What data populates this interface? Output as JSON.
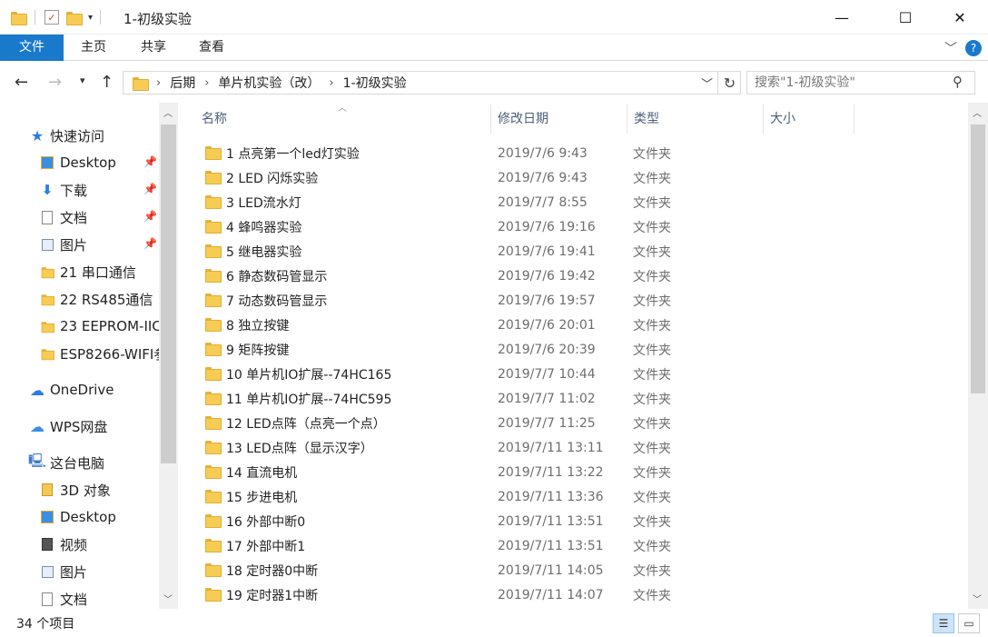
{
  "window": {
    "title": "1-初级实验",
    "minimize": "—",
    "maximize": "☐",
    "close": "✕"
  },
  "ribbon": {
    "tabs": [
      "文件",
      "主页",
      "共享",
      "查看"
    ],
    "help": "?"
  },
  "address": {
    "crumbs": [
      "后期",
      "单片机实验（改）",
      "1-初级实验"
    ]
  },
  "search": {
    "placeholder": "搜索\"1-初级实验\""
  },
  "navpane": {
    "quick_access": "快速访问",
    "items": [
      {
        "label": "Desktop",
        "pinned": true
      },
      {
        "label": "下载",
        "pinned": true
      },
      {
        "label": "文档",
        "pinned": true
      },
      {
        "label": "图片",
        "pinned": true
      },
      {
        "label": "21 串口通信",
        "pinned": false
      },
      {
        "label": "22 RS485通信",
        "pinned": false
      },
      {
        "label": "23 EEPROM-IIC",
        "pinned": false
      },
      {
        "label": "ESP8266-WIFI参",
        "pinned": false
      }
    ],
    "onedrive": "OneDrive",
    "wps": "WPS网盘",
    "this_pc": "这台电脑",
    "pc_items": [
      "3D 对象",
      "Desktop",
      "视频",
      "图片",
      "文档"
    ]
  },
  "columns": {
    "name": "名称",
    "date": "修改日期",
    "type": "类型",
    "size": "大小"
  },
  "files": [
    {
      "name": "1 点亮第一个led灯实验",
      "date": "2019/7/6 9:43",
      "type": "文件夹"
    },
    {
      "name": "2 LED 闪烁实验",
      "date": "2019/7/6 9:43",
      "type": "文件夹"
    },
    {
      "name": "3 LED流水灯",
      "date": "2019/7/7 8:55",
      "type": "文件夹"
    },
    {
      "name": "4 蜂鸣器实验",
      "date": "2019/7/6 19:16",
      "type": "文件夹"
    },
    {
      "name": "5 继电器实验",
      "date": "2019/7/6 19:41",
      "type": "文件夹"
    },
    {
      "name": "6 静态数码管显示",
      "date": "2019/7/6 19:42",
      "type": "文件夹"
    },
    {
      "name": "7 动态数码管显示",
      "date": "2019/7/6 19:57",
      "type": "文件夹"
    },
    {
      "name": "8 独立按键",
      "date": "2019/7/6 20:01",
      "type": "文件夹"
    },
    {
      "name": "9 矩阵按键",
      "date": "2019/7/6 20:39",
      "type": "文件夹"
    },
    {
      "name": "10 单片机IO扩展--74HC165",
      "date": "2019/7/7 10:44",
      "type": "文件夹"
    },
    {
      "name": "11 单片机IO扩展--74HC595",
      "date": "2019/7/7 11:02",
      "type": "文件夹"
    },
    {
      "name": "12 LED点阵（点亮一个点）",
      "date": "2019/7/7 11:25",
      "type": "文件夹"
    },
    {
      "name": "13 LED点阵（显示汉字）",
      "date": "2019/7/11 13:11",
      "type": "文件夹"
    },
    {
      "name": "14 直流电机",
      "date": "2019/7/11 13:22",
      "type": "文件夹"
    },
    {
      "name": "15 步进电机",
      "date": "2019/7/11 13:36",
      "type": "文件夹"
    },
    {
      "name": "16 外部中断0",
      "date": "2019/7/11 13:51",
      "type": "文件夹"
    },
    {
      "name": "17 外部中断1",
      "date": "2019/7/11 13:51",
      "type": "文件夹"
    },
    {
      "name": "18 定时器0中断",
      "date": "2019/7/11 14:05",
      "type": "文件夹"
    },
    {
      "name": "19 定时器1中断",
      "date": "2019/7/11 14:07",
      "type": "文件夹"
    }
  ],
  "status": {
    "count": "34 个项目"
  },
  "colors": {
    "accent": "#1979ca",
    "folder": "#f6cc55",
    "header_text": "#4c607a"
  }
}
